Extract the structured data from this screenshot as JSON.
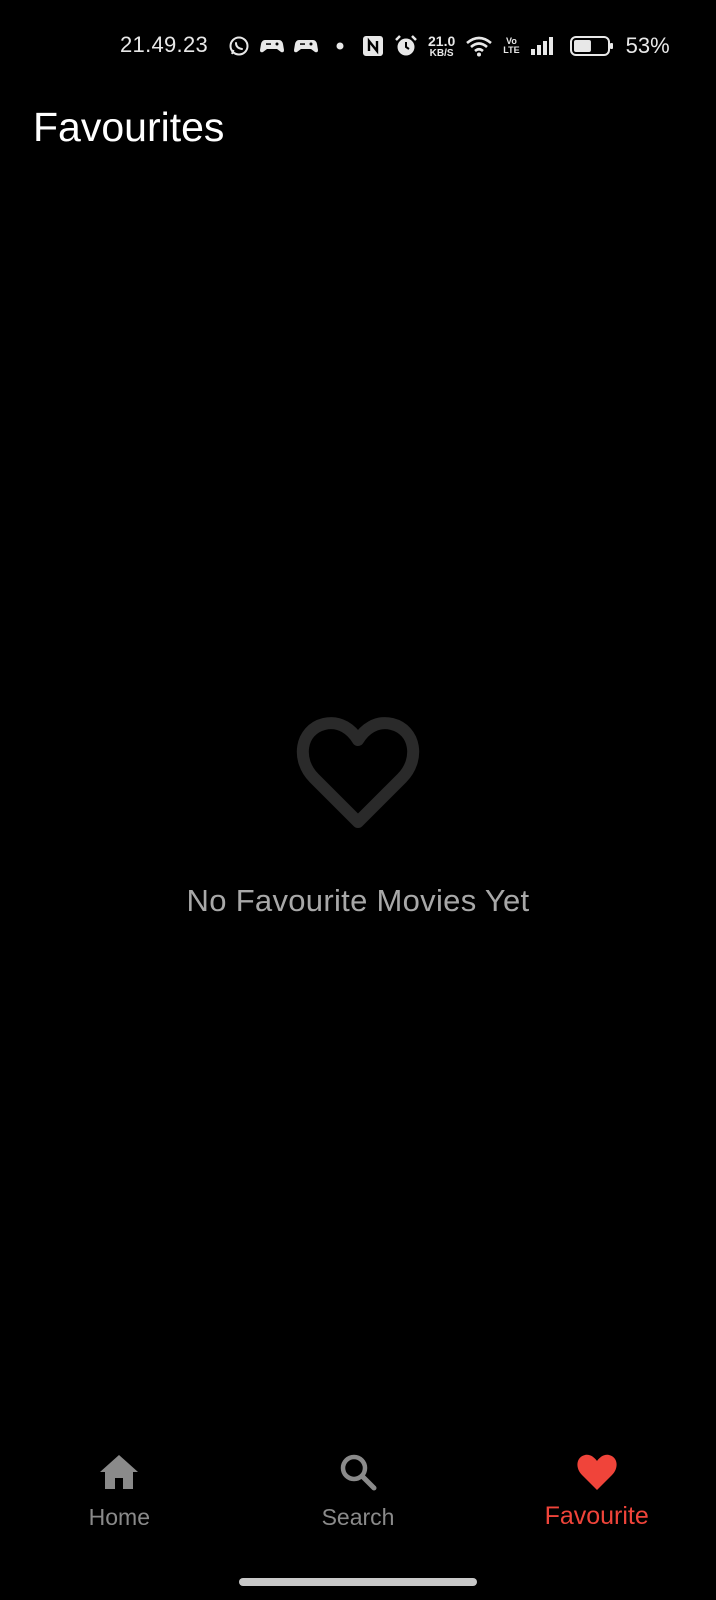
{
  "status_bar": {
    "time": "21.49.23",
    "net_speed_value": "21.0",
    "net_speed_unit": "KB/S",
    "volte_top": "Vo",
    "volte_bottom": "LTE",
    "battery_percent": "53%",
    "battery_level": 0.53,
    "icons": [
      "whatsapp-icon",
      "game-controller-icon",
      "game-controller-icon",
      "dot-icon",
      "nfc-icon",
      "alarm-icon",
      "wifi-icon",
      "signal-icon",
      "battery-icon"
    ]
  },
  "header": {
    "title": "Favourites"
  },
  "empty_state": {
    "icon": "heart-outline-icon",
    "message": "No Favourite Movies Yet"
  },
  "bottom_nav": {
    "items": [
      {
        "label": "Home",
        "icon": "home-icon",
        "active": false
      },
      {
        "label": "Search",
        "icon": "search-icon",
        "active": false
      },
      {
        "label": "Favourite",
        "icon": "heart-icon",
        "active": true
      }
    ]
  },
  "colors": {
    "background": "#000000",
    "accent": "#f0443a",
    "inactive": "#8a8a8a",
    "empty_icon": "#2a2a2a"
  }
}
